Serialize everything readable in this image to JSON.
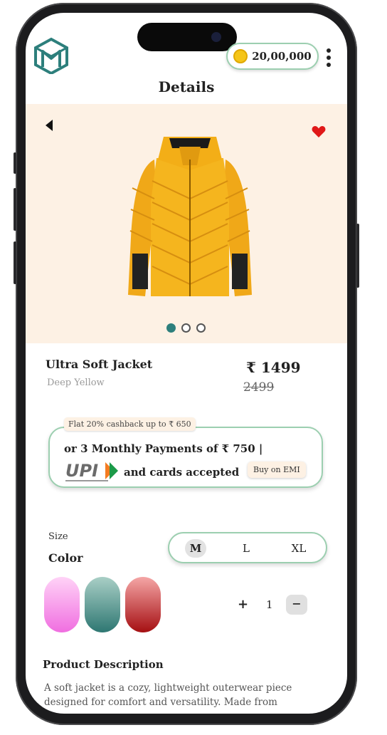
{
  "header": {
    "title": "Details",
    "coin_balance": "20,00,000",
    "logo_icon": "brand-logo-icon"
  },
  "product": {
    "name": "Ultra Soft Jacket",
    "variant": "Deep Yellow",
    "price": "₹ 1499",
    "original_price": "2499",
    "image_dots_total": 3,
    "image_dots_active": 1
  },
  "offer": {
    "cashback": "Flat 20% cashback up to ₹ 650",
    "emi_text": "or 3 Monthly Payments of  ₹  750 |",
    "payment_logo_text": "UPI",
    "cards_text": "and cards accepted",
    "emi_button": "Buy on EMI"
  },
  "options": {
    "size_label": "Size",
    "color_label": "Color",
    "sizes": [
      "M",
      "L",
      "XL"
    ],
    "selected_size": "M",
    "swatches": [
      {
        "name": "pink",
        "top": "#ffd3f7",
        "bottom": "#f06ee0"
      },
      {
        "name": "teal",
        "top": "#a9cfc6",
        "bottom": "#2e7772"
      },
      {
        "name": "red",
        "top": "#f5a6a6",
        "bottom": "#a50f12"
      }
    ],
    "quantity_plus": "+",
    "quantity": "1",
    "quantity_minus": "−"
  },
  "description": {
    "title": "Product Description",
    "text": "A soft jacket is a cozy, lightweight outerwear piece designed for comfort and versatility. Made from"
  },
  "colors": {
    "accent": "#2d7f7c",
    "pill_border": "#9ccfb0",
    "hero_bg": "#fdf1e4",
    "heart": "#e01818",
    "jacket": "#f2b21c"
  }
}
